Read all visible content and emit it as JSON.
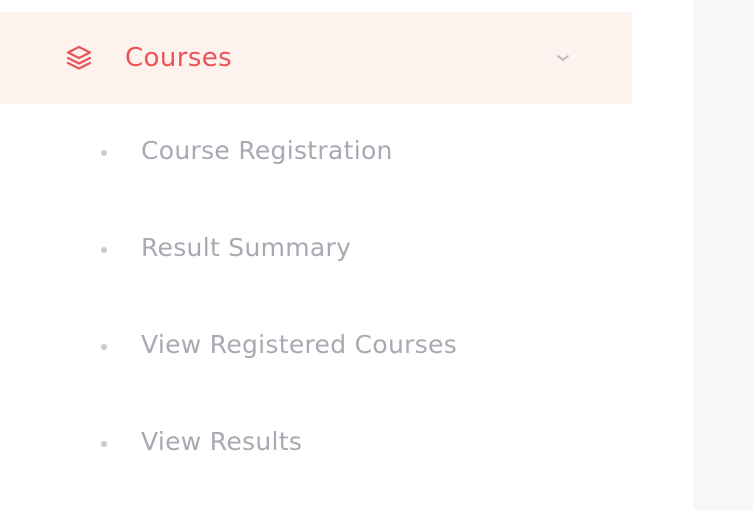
{
  "sidebar": {
    "menu": {
      "label": "Courses",
      "icon": "layers-icon",
      "expanded": true,
      "accent_color": "#ea5455",
      "active_bg_color": "#fdf2ed",
      "items": [
        {
          "label": "Course Registration"
        },
        {
          "label": "Result Summary"
        },
        {
          "label": "View Registered Courses"
        },
        {
          "label": "View Results"
        }
      ]
    }
  }
}
